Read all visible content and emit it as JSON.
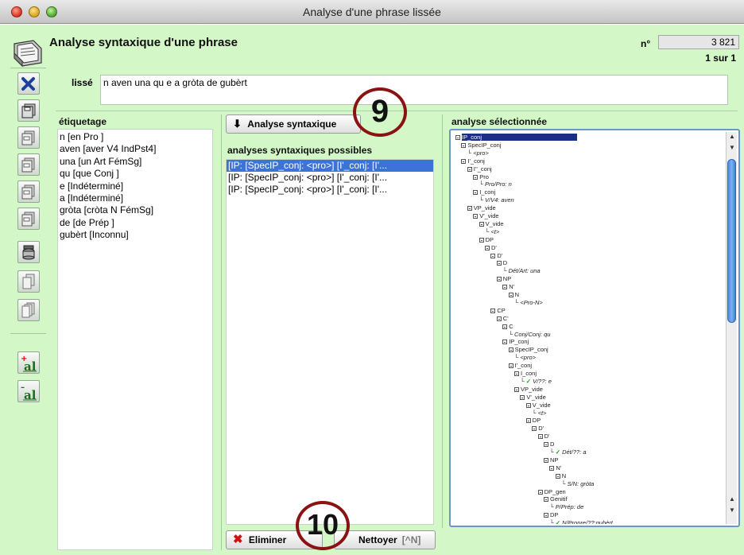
{
  "window": {
    "title": "Analyse d'une phrase lissée"
  },
  "header": {
    "title": "Analyse syntaxique d'une phrase",
    "number_label": "n°",
    "number_value": "3 821",
    "pager": "1 sur 1"
  },
  "lisse": {
    "label": "lissé",
    "value": "n aven una qu e a gròta de gubèrt"
  },
  "etiquetage": {
    "label": "étiquetage",
    "items": [
      "n [en Pro ]",
      "aven [aver V4 IndPst4]",
      "una [un Art FémSg]",
      "qu [que Conj ]",
      "e [Indéterminé]",
      "a [Indéterminé]",
      "gròta [cròta N FémSg]",
      "de [de Prép ]",
      "gubèrt [Inconnu]"
    ]
  },
  "middle": {
    "analyse_button": "Analyse syntaxique",
    "list_label": "analyses syntaxiques possibles",
    "items": [
      "[IP: [SpecIP_conj: <pro>] [I'_conj: [I'...",
      "[IP: [SpecIP_conj: <pro>] [I'_conj: [I'...",
      "[IP: [SpecIP_conj: <pro>] [I'_conj: [I'..."
    ],
    "eliminer_button": "Eliminer",
    "nettoyer_button": "Nettoyer",
    "nettoyer_shortcut": "[^N]"
  },
  "tree": {
    "label": "analyse sélectionnée",
    "nodes": [
      "IP_conj",
      "SpecIP_conj",
      "<pro>",
      "I'_conj",
      "I''_conj",
      "Pro",
      "Pro/Pro: n",
      "I_conj",
      "V/V4: aven",
      "VP_vide",
      "V'_vide",
      "V_vide",
      "<t>",
      "DP",
      "D'",
      "D'",
      "D",
      "Dét/Art: una",
      "NP",
      "N'",
      "N",
      "<Pro-N>",
      "CP",
      "C'",
      "C",
      "Conj/Conj: qu",
      "IP_conj",
      "SpecIP_conj",
      "<pro>",
      "I'_conj",
      "I_conj",
      "V/??: e",
      "VP_vide",
      "V'_vide",
      "V_vide",
      "<t>",
      "DP",
      "D'",
      "D'",
      "D",
      "Dét/??: a",
      "NP",
      "N'",
      "N",
      "S/N: gròta",
      "DP_gen",
      "Genitif",
      "P/Prép: de",
      "DP",
      "N/Propre/??:gubèrt"
    ]
  },
  "annotations": {
    "badge_9": "9",
    "badge_10": "10"
  },
  "colors": {
    "window_bg": "#d3f7c7",
    "selection": "#3b73d6",
    "badge_ring": "#8b1212"
  }
}
